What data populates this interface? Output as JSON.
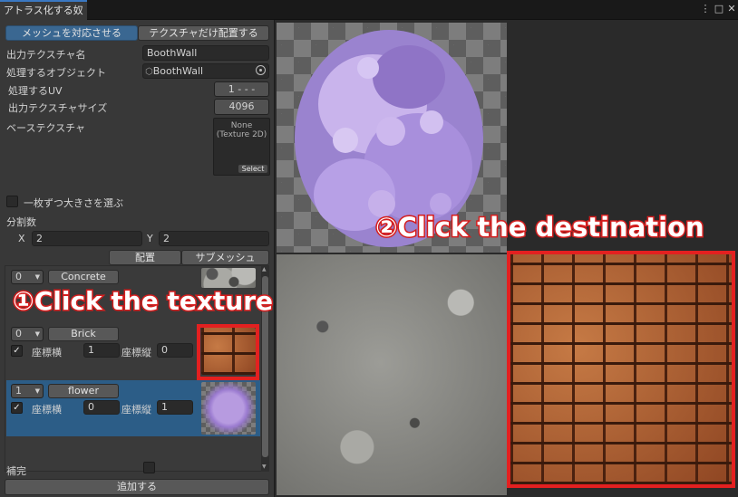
{
  "window": {
    "tab_title": "アトラス化する奴",
    "controls": {
      "menu": "⋮",
      "maximize": "□",
      "close": "✕"
    }
  },
  "mode_tabs": {
    "left": "メッシュを対応させる",
    "right": "テクスチャだけ配置する"
  },
  "settings": {
    "output_texture_name_label": "出力テクスチャ名",
    "output_texture_name_value": "BoothWall",
    "target_object_label": "処理するオブジェクト",
    "target_object_value": "BoothWall",
    "uv_label": "処理するUV",
    "uv_value": "1 - - -",
    "output_size_label": "出力テクスチャサイズ",
    "output_size_value": "4096",
    "base_texture_label": "ベーステクスチャ",
    "base_texture_none": "None",
    "base_texture_type": "(Texture 2D)",
    "base_texture_select": "Select",
    "choose_size_label": "一枚ずつ大きさを選ぶ"
  },
  "division": {
    "label": "分割数",
    "x_label": "X",
    "x_value": "2",
    "y_label": "Y",
    "y_value": "2"
  },
  "list_header": {
    "placement": "配置",
    "submesh": "サブメッシュ"
  },
  "textures": [
    {
      "index": "0",
      "name": "Concrete",
      "has_coords": false
    },
    {
      "index": "0",
      "name": "Brick",
      "has_coords": true,
      "checked": true,
      "coord_h_label": "座標横",
      "coord_h": "1",
      "coord_v_label": "座標縦",
      "coord_v": "0"
    },
    {
      "index": "1",
      "name": "flower",
      "has_coords": true,
      "checked": true,
      "selected": true,
      "coord_h_label": "座標横",
      "coord_h": "0",
      "coord_v_label": "座標縦",
      "coord_v": "1"
    }
  ],
  "footer": {
    "complement_label": "補完",
    "add_button": "追加する"
  },
  "annotations": {
    "step1": "①Click the texture",
    "step2": "②Click the destination",
    "color": "#e32020"
  },
  "icons": {
    "dropdown": "▼",
    "check": "✓",
    "object": "cube-icon",
    "target": "target-icon"
  }
}
